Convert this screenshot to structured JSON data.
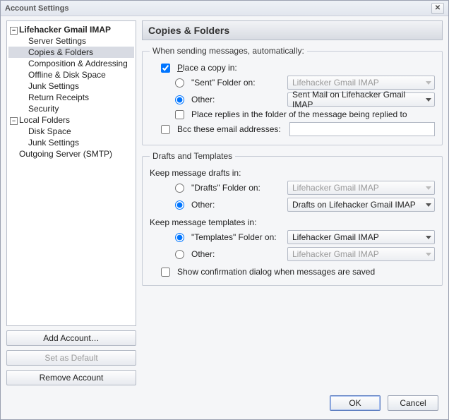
{
  "window": {
    "title": "Account Settings"
  },
  "tree": {
    "accounts": [
      {
        "name": "Lifehacker Gmail IMAP",
        "bold": true,
        "children": [
          "Server Settings",
          "Copies & Folders",
          "Composition & Addressing",
          "Offline & Disk Space",
          "Junk Settings",
          "Return Receipts",
          "Security"
        ],
        "selectedChild": "Copies & Folders"
      },
      {
        "name": "Local Folders",
        "bold": false,
        "children": [
          "Disk Space",
          "Junk Settings"
        ]
      },
      {
        "name": "Outgoing Server (SMTP)",
        "bold": false,
        "children": []
      }
    ]
  },
  "buttons": {
    "add_account": "Add Account…",
    "set_default": "Set as Default",
    "remove_account": "Remove Account"
  },
  "header": {
    "title": "Copies & Folders"
  },
  "sending": {
    "legend": "When sending messages, automatically:",
    "place_copy": {
      "checked": true,
      "label_pre": "P",
      "label_post": "lace a copy in:"
    },
    "sent_radio": {
      "checked": false,
      "label": "\"Sent\" Folder on:"
    },
    "sent_select": {
      "value": "Lifehacker Gmail IMAP",
      "enabled": false
    },
    "other_radio": {
      "checked": true,
      "label": "Other:"
    },
    "other_select": {
      "value": "Sent Mail on Lifehacker Gmail IMAP",
      "enabled": true
    },
    "place_replies": {
      "checked": false,
      "label": "Place replies in the folder of the message being replied to"
    },
    "bcc": {
      "checked": false,
      "label": "Bcc these email addresses:",
      "value": ""
    }
  },
  "drafts": {
    "legend": "Drafts and Templates",
    "keep_drafts_label": "Keep message drafts in:",
    "drafts_radio": {
      "checked": false,
      "label": "\"Drafts\" Folder on:"
    },
    "drafts_select": {
      "value": "Lifehacker Gmail IMAP",
      "enabled": false
    },
    "drafts_other_radio": {
      "checked": true,
      "label": "Other:"
    },
    "drafts_other_select": {
      "value": "Drafts on Lifehacker Gmail IMAP",
      "enabled": true
    },
    "keep_templates_label": "Keep message templates in:",
    "templates_radio": {
      "checked": true,
      "label": "\"Templates\" Folder on:"
    },
    "templates_select": {
      "value": "Lifehacker Gmail IMAP",
      "enabled": true
    },
    "templates_other_radio": {
      "checked": false,
      "label": "Other:"
    },
    "templates_other_select": {
      "value": "Lifehacker Gmail IMAP",
      "enabled": false
    },
    "show_confirm": {
      "checked": false,
      "label": "Show confirmation dialog when messages are saved"
    }
  },
  "footer": {
    "ok": "OK",
    "cancel": "Cancel"
  }
}
